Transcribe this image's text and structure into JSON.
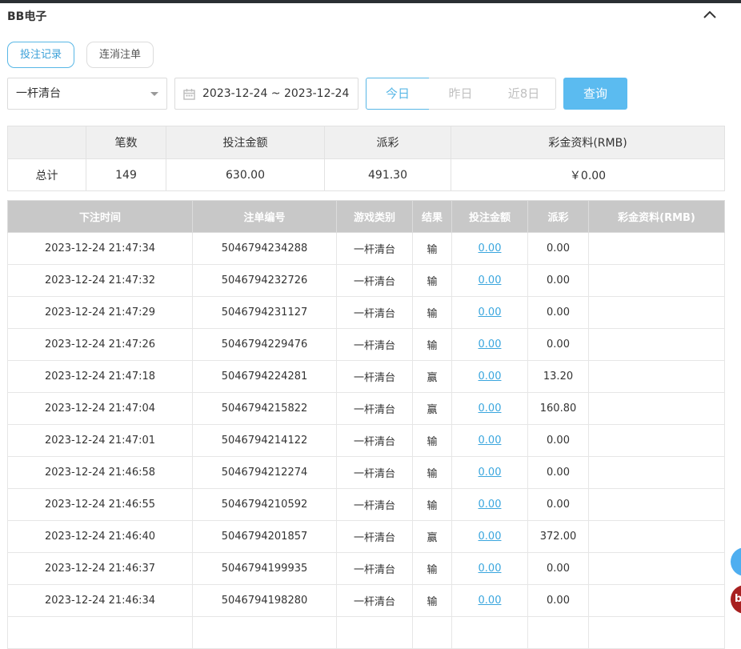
{
  "header": {
    "title": "BB电子"
  },
  "tabs": [
    {
      "label": "投注记录"
    },
    {
      "label": "连消注单"
    }
  ],
  "filters": {
    "game_select": "一杆清台",
    "date_range": "2023-12-24 ~ 2023-12-24",
    "quick_ranges": [
      "今日",
      "昨日",
      "近8日"
    ],
    "query_label": "查询"
  },
  "summary": {
    "headers": [
      "",
      "笔数",
      "投注金额",
      "派彩",
      "彩金资料(RMB)"
    ],
    "row": [
      "总计",
      "149",
      "630.00",
      "491.30",
      "￥0.00"
    ]
  },
  "records": {
    "headers": [
      "下注时间",
      "注单编号",
      "游戏类别",
      "结果",
      "投注金额",
      "派彩",
      "彩金资料(RMB)"
    ],
    "rows": [
      [
        "2023-12-24 21:47:34",
        "5046794234288",
        "一杆清台",
        "输",
        "0.00",
        "0.00",
        ""
      ],
      [
        "2023-12-24 21:47:32",
        "5046794232726",
        "一杆清台",
        "输",
        "0.00",
        "0.00",
        ""
      ],
      [
        "2023-12-24 21:47:29",
        "5046794231127",
        "一杆清台",
        "输",
        "0.00",
        "0.00",
        ""
      ],
      [
        "2023-12-24 21:47:26",
        "5046794229476",
        "一杆清台",
        "输",
        "0.00",
        "0.00",
        ""
      ],
      [
        "2023-12-24 21:47:18",
        "5046794224281",
        "一杆清台",
        "赢",
        "0.00",
        "13.20",
        ""
      ],
      [
        "2023-12-24 21:47:04",
        "5046794215822",
        "一杆清台",
        "赢",
        "0.00",
        "160.80",
        ""
      ],
      [
        "2023-12-24 21:47:01",
        "5046794214122",
        "一杆清台",
        "输",
        "0.00",
        "0.00",
        ""
      ],
      [
        "2023-12-24 21:46:58",
        "5046794212274",
        "一杆清台",
        "输",
        "0.00",
        "0.00",
        ""
      ],
      [
        "2023-12-24 21:46:55",
        "5046794210592",
        "一杆清台",
        "输",
        "0.00",
        "0.00",
        ""
      ],
      [
        "2023-12-24 21:46:40",
        "5046794201857",
        "一杆清台",
        "赢",
        "0.00",
        "372.00",
        ""
      ],
      [
        "2023-12-24 21:46:37",
        "5046794199935",
        "一杆清台",
        "输",
        "0.00",
        "0.00",
        ""
      ],
      [
        "2023-12-24 21:46:34",
        "5046794198280",
        "一杆清台",
        "输",
        "0.00",
        "0.00",
        ""
      ],
      [
        "",
        "",
        "",
        "",
        "",
        "",
        ""
      ]
    ]
  },
  "floating": {
    "badge_text": "b"
  },
  "colors": {
    "accent": "#58b7e6",
    "query_bg": "#5bbbf0",
    "header_bg": "#c8c8c8",
    "link": "#3aa6de"
  },
  "icons": {
    "collapse": "chevron-up-icon",
    "calendar": "calendar-icon",
    "dropdown": "caret-down-icon"
  }
}
